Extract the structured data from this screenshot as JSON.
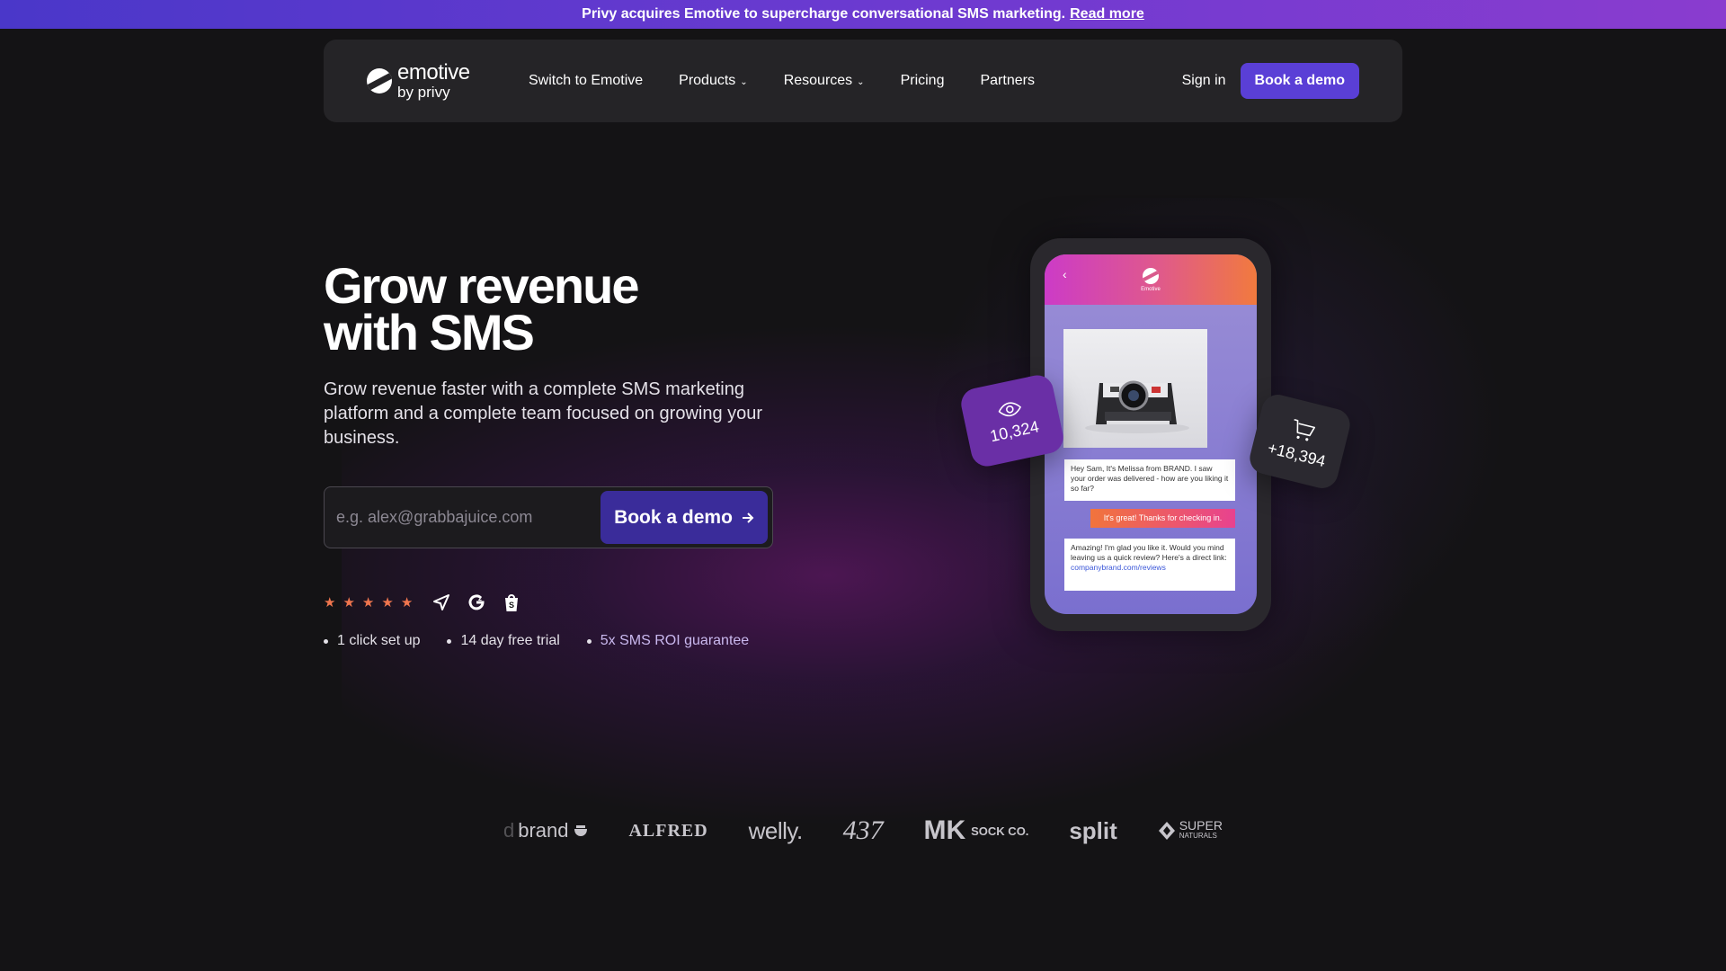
{
  "announcement": {
    "text": "Privy acquires Emotive to supercharge conversational SMS marketing.",
    "link": "Read more"
  },
  "nav": {
    "logo_name": "emotive",
    "logo_sub": "by privy",
    "links": [
      {
        "label": "Switch to Emotive",
        "dropdown": false
      },
      {
        "label": "Products",
        "dropdown": true
      },
      {
        "label": "Resources",
        "dropdown": true
      },
      {
        "label": "Pricing",
        "dropdown": false
      },
      {
        "label": "Partners",
        "dropdown": false
      }
    ],
    "signin": "Sign in",
    "cta": "Book a demo"
  },
  "hero": {
    "title_line1": "Grow revenue",
    "title_line2": "with SMS",
    "subtitle": "Grow revenue faster with a complete SMS marketing platform and a complete team focused on growing your business.",
    "email_placeholder": "e.g. alex@grabbajuice.com",
    "cta": "Book a demo",
    "rating_stars": 5,
    "bullets": [
      "1 click set up",
      "14 day free trial",
      "5x SMS ROI guarantee"
    ]
  },
  "phone": {
    "brand": "Emotive",
    "msg1": "Hey Sam, It's Melissa from BRAND. I saw your order was delivered - how are you liking it so far?",
    "msg2": "It's great! Thanks for checking in.",
    "msg3": "Amazing! I'm glad you like it. Would you mind leaving us a quick review? Here's a direct link:",
    "msg3_link": "companybrand.com/reviews",
    "views_count": "10,324",
    "cart_count": "+18,394"
  },
  "brands": {
    "dbrand_pre": "d",
    "dbrand": "brand",
    "alfred": "ALFRED",
    "welly": "welly.",
    "b437": "437",
    "mk": "MK",
    "mk_sub": "SOCK CO.",
    "split": "split",
    "super": "SUPER",
    "super_sub": "NATURALS"
  },
  "colors": {
    "accent": "#5a3fd6",
    "background": "#141315",
    "star": "#f0764e"
  }
}
